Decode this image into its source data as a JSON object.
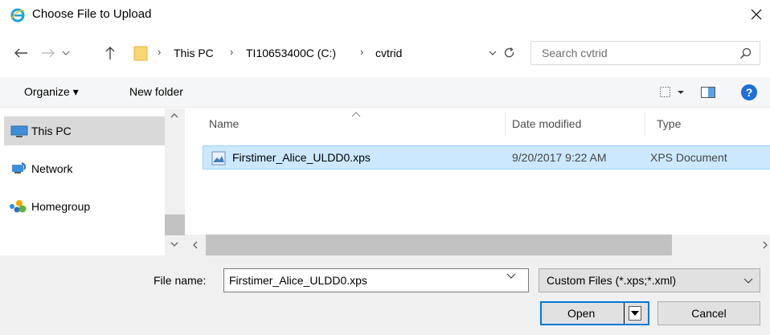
{
  "window": {
    "title": "Choose File to Upload",
    "icon": "ie-icon",
    "close_icon": "close-icon"
  },
  "address": {
    "crumbs": [
      "This PC",
      "TI10653400C (C:)",
      "cvtrid"
    ],
    "search_placeholder": "Search cvtrid"
  },
  "toolbar": {
    "organize_label": "Organize ▾",
    "new_folder_label": "New folder"
  },
  "nav": {
    "items": [
      {
        "label": "This PC",
        "icon": "computer-icon",
        "selected": true
      },
      {
        "label": "Network",
        "icon": "network-icon",
        "selected": false
      },
      {
        "label": "Homegroup",
        "icon": "homegroup-icon",
        "selected": false
      }
    ]
  },
  "files": {
    "columns": [
      "Name",
      "Date modified",
      "Type"
    ],
    "rows": [
      {
        "name": "Firstimer_Alice_ULDD0.xps",
        "date": "9/20/2017 9:22 AM",
        "type": "XPS Document",
        "selected": true
      }
    ]
  },
  "bottom": {
    "file_name_label": "File name:",
    "file_name_value": "Firstimer_Alice_ULDD0.xps",
    "filter_label": "Custom Files (*.xps;*.xml)",
    "open_label": "Open",
    "cancel_label": "Cancel"
  },
  "colors": {
    "accent": "#0078d7",
    "selection": "#cce8ff",
    "help": "#1e6fd9"
  }
}
